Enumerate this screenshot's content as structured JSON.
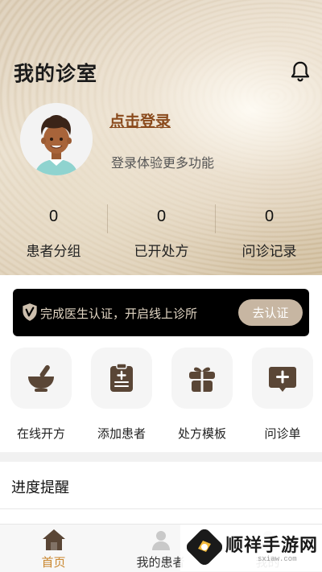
{
  "header": {
    "title": "我的诊室",
    "bell_icon": "bell-icon"
  },
  "profile": {
    "avatar_icon": "doctor-avatar",
    "login_link": "点击登录",
    "login_sub": "登录体验更多功能"
  },
  "stats": [
    {
      "value": "0",
      "label": "患者分组"
    },
    {
      "value": "0",
      "label": "已开处方"
    },
    {
      "value": "0",
      "label": "问诊记录"
    }
  ],
  "cert_banner": {
    "icon": "verified-shield-icon",
    "text": "完成医生认证，开启线上诊所",
    "button": "去认证"
  },
  "tools": [
    {
      "label": "在线开方",
      "icon": "mortar-pestle-icon"
    },
    {
      "label": "添加患者",
      "icon": "clipboard-add-icon"
    },
    {
      "label": "处方模板",
      "icon": "gift-box-icon"
    },
    {
      "label": "问诊单",
      "icon": "chat-plus-icon"
    }
  ],
  "progress": {
    "title": "进度提醒"
  },
  "tabbar": {
    "items": [
      {
        "label": "首页",
        "icon": "home-icon",
        "active": true
      },
      {
        "label": "我的患者",
        "icon": "patients-icon",
        "active": false
      },
      {
        "label": "我的",
        "icon": "profile-icon",
        "active": false
      }
    ]
  },
  "watermark": {
    "text": "顺祥手游网",
    "url": "sxiaw.com"
  },
  "colors": {
    "accent": "#c9862d",
    "login_link": "#8a4a1c",
    "icon_brown": "#5a4636",
    "banner_bg": "#000000",
    "banner_button": "#c7b6a2"
  }
}
